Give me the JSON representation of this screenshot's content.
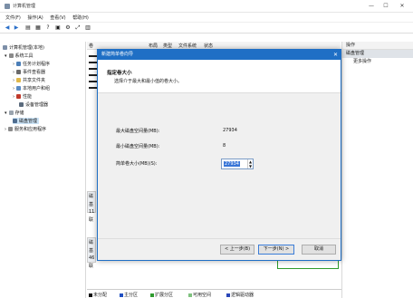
{
  "window": {
    "title": "计算机管理",
    "minimize": "—",
    "maximize": "☐",
    "close": "✕"
  },
  "menu": [
    "文件(F)",
    "操作(A)",
    "查看(V)",
    "帮助(H)"
  ],
  "toolbar": [
    "◀",
    "▶",
    "▤",
    "▦",
    "?",
    "▣",
    "⚙",
    "⤢",
    "▥"
  ],
  "tree": {
    "root": "计算机管理(本地)",
    "system_tools": "系统工具",
    "items": [
      "任务计划程序",
      "事件查看器",
      "共享文件夹",
      "本地用户和组",
      "性能",
      "设备管理器"
    ],
    "storage": "存储",
    "disk_mgmt": "磁盘管理",
    "services": "服务和应用程序"
  },
  "list_columns": [
    "卷",
    "布局",
    "类型",
    "文件系统",
    "状态"
  ],
  "disk_cards": [
    {
      "lines": [
        "磁",
        "基",
        "11",
        "联"
      ]
    },
    {
      "lines": [
        "磁",
        "基",
        "46",
        "联"
      ]
    }
  ],
  "legend": [
    "未分配",
    "主分区",
    "扩展分区",
    "可用空间",
    "逻辑驱动器"
  ],
  "legend_colors": [
    "#111111",
    "#1f4fc2",
    "#2e9b2e",
    "#7fc27f",
    "#2a47b8"
  ],
  "actions": {
    "header": "操作",
    "section": "磁盘管理",
    "more": "更多操作"
  },
  "dialog": {
    "title": "新建简单卷向导",
    "close": "✕",
    "heading": "指定卷大小",
    "subheading": "选择介于最大和最小值的卷大小。",
    "max_label": "最大磁盘空间量(MB):",
    "max_value": "27934",
    "min_label": "最小磁盘空间量(MB):",
    "min_value": "8",
    "size_label": "简单卷大小(MB)(S):",
    "size_value": "27934",
    "back_button": "< 上一步(B)",
    "next_button": "下一步(N) >",
    "cancel_button": "取消"
  }
}
